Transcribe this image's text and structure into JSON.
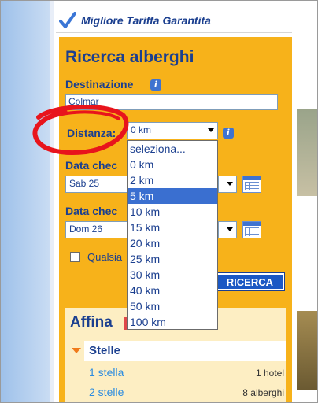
{
  "banner": {
    "guarantee_text": "Migliore Tariffa Garantita"
  },
  "search": {
    "title": "Ricerca alberghi",
    "destination_label": "Destinazione",
    "destination_value": "Colmar",
    "distance_label": "Distanza:",
    "distance_value": "0 km",
    "checkin_label": "Data chec",
    "checkin_value": "Sab 25",
    "checkout_label": "Data chec",
    "checkout_value": "Dom 26",
    "anydate_label": "Qualsia",
    "search_button": "RICERCA"
  },
  "distance_options": [
    "seleziona...",
    "0 km",
    "2 km",
    "5 km",
    "10 km",
    "15 km",
    "20 km",
    "25 km",
    "30 km",
    "40 km",
    "50 km",
    "100 km"
  ],
  "distance_selected_index": 3,
  "refine": {
    "title": "Affina",
    "stars_heading": "Stelle",
    "rows": [
      {
        "label": "1 stella",
        "count": "1 hotel"
      },
      {
        "label": "2 stelle",
        "count": "8 alberghi"
      }
    ]
  },
  "colors": {
    "panel": "#f7b21a",
    "brand_blue": "#1b3f8f",
    "link_blue": "#2a8be0",
    "highlight": "#3a6fd0",
    "annotation_red": "#e8141c"
  },
  "icons": [
    "check-icon",
    "info-icon",
    "dropdown-arrow-icon",
    "calendar-icon",
    "expand-arrow-icon"
  ]
}
